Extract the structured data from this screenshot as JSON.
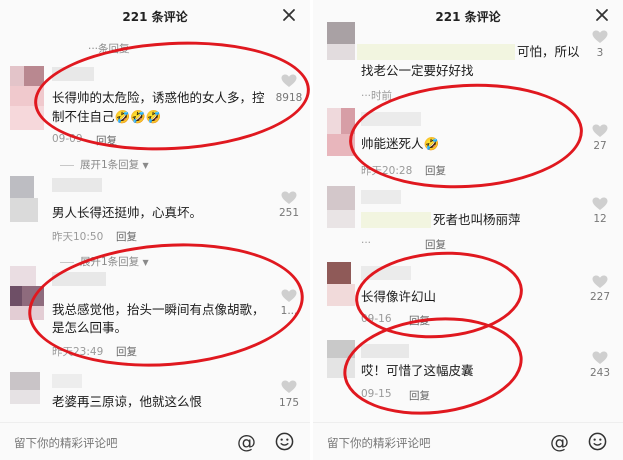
{
  "left": {
    "title": "221 条评论",
    "footer_placeholder": "留下你的精彩评论吧",
    "at_glyph": "@",
    "comments": [
      {
        "reply_hint": "···条回复",
        "line1": "长得帅的太危险，诱惑他的女人多，控",
        "line2": "制不住自己🤣🤣🤣",
        "time": "09-09",
        "reply": "回复",
        "likes": "8918",
        "expand": "展开1条回复"
      },
      {
        "line1": "男人长得还挺帅，心真坏。",
        "time": "昨天10:50",
        "reply": "回复",
        "likes": "251"
      },
      {
        "expand": "展开1条回复",
        "line1": "我总感觉他，抬头一瞬间有点像胡歌，",
        "line2": "是怎么回事。",
        "time": "昨天23:49",
        "reply": "回复",
        "likes": "1..."
      },
      {
        "line1": "老婆再三原谅，他就这么恨",
        "likes": "175"
      }
    ]
  },
  "right": {
    "title": "221 条评论",
    "footer_placeholder": "留下你的精彩评论吧",
    "at_glyph": "@",
    "comments": [
      {
        "line1_end": "可怕，所以",
        "line2": "找老公一定要好好找",
        "time": "···时前",
        "reply": "回复",
        "likes": "3"
      },
      {
        "line1": "帅能迷死人🤣",
        "time": "昨天20:28",
        "reply": "回复",
        "likes": "27"
      },
      {
        "line1": "死者也叫杨丽萍",
        "time": "···",
        "reply": "回复",
        "likes": "12"
      },
      {
        "line1": "长得像许幻山",
        "time": "09-16",
        "reply": "回复",
        "likes": "227"
      },
      {
        "line1": "哎！可惜了这幅皮囊",
        "time": "09-15",
        "reply": "回复",
        "likes": "243"
      }
    ]
  },
  "colors": {
    "annotation_red": "#e0181f",
    "heart": "#cfcfcf"
  }
}
